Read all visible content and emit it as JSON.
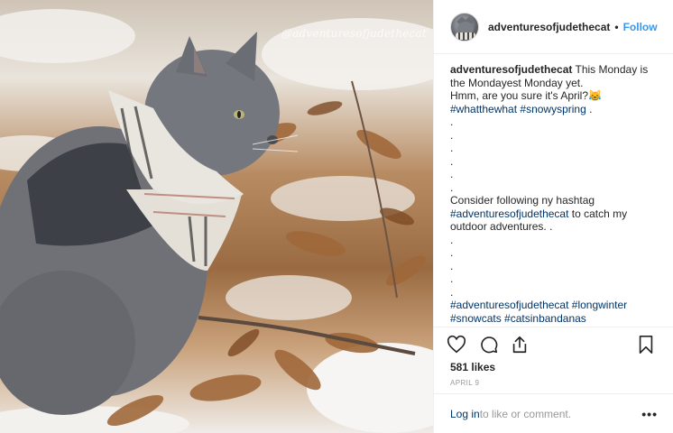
{
  "post": {
    "photo": {
      "watermark": "@adventuresofjudethecat",
      "subject": "cat-photo"
    },
    "header": {
      "username": "adventuresofjudethecat",
      "separator": "•",
      "follow_label": "Follow"
    },
    "caption": {
      "username": "adventuresofjudethecat",
      "line1": " This Monday is the Mondayest Monday yet.",
      "line2": "Hmm, are you sure it's April?😹",
      "tag1": "#whatthewhat",
      "tag2": "#snowyspring",
      "tag_end": " .",
      "dots_a": ".\n.\n.\n.\n.\n.",
      "line3": "Consider following ny hashtag ",
      "tag3": "#adventuresofjudethecat",
      "line4": " to catch my outdoor adventures. .",
      "dots_b": ".\n.\n.\n.\n.",
      "tag4": "#adventuresofjudethecat",
      "tag5": "#longwinter",
      "tag6": "#snowcats",
      "tag7": "#catsinbandanas"
    },
    "actions": {
      "like_icon": "heart-icon",
      "comment_icon": "comment-icon",
      "share_icon": "share-icon",
      "save_icon": "bookmark-icon"
    },
    "likes": "581 likes",
    "date": "APRIL 9",
    "comment": {
      "login_label": "Log in",
      "rest_label": " to like or comment.",
      "more_label": "•••"
    }
  },
  "colors": {
    "link": "#3897f0",
    "hashtag": "#003569",
    "muted": "#999999",
    "border": "#efefef"
  }
}
